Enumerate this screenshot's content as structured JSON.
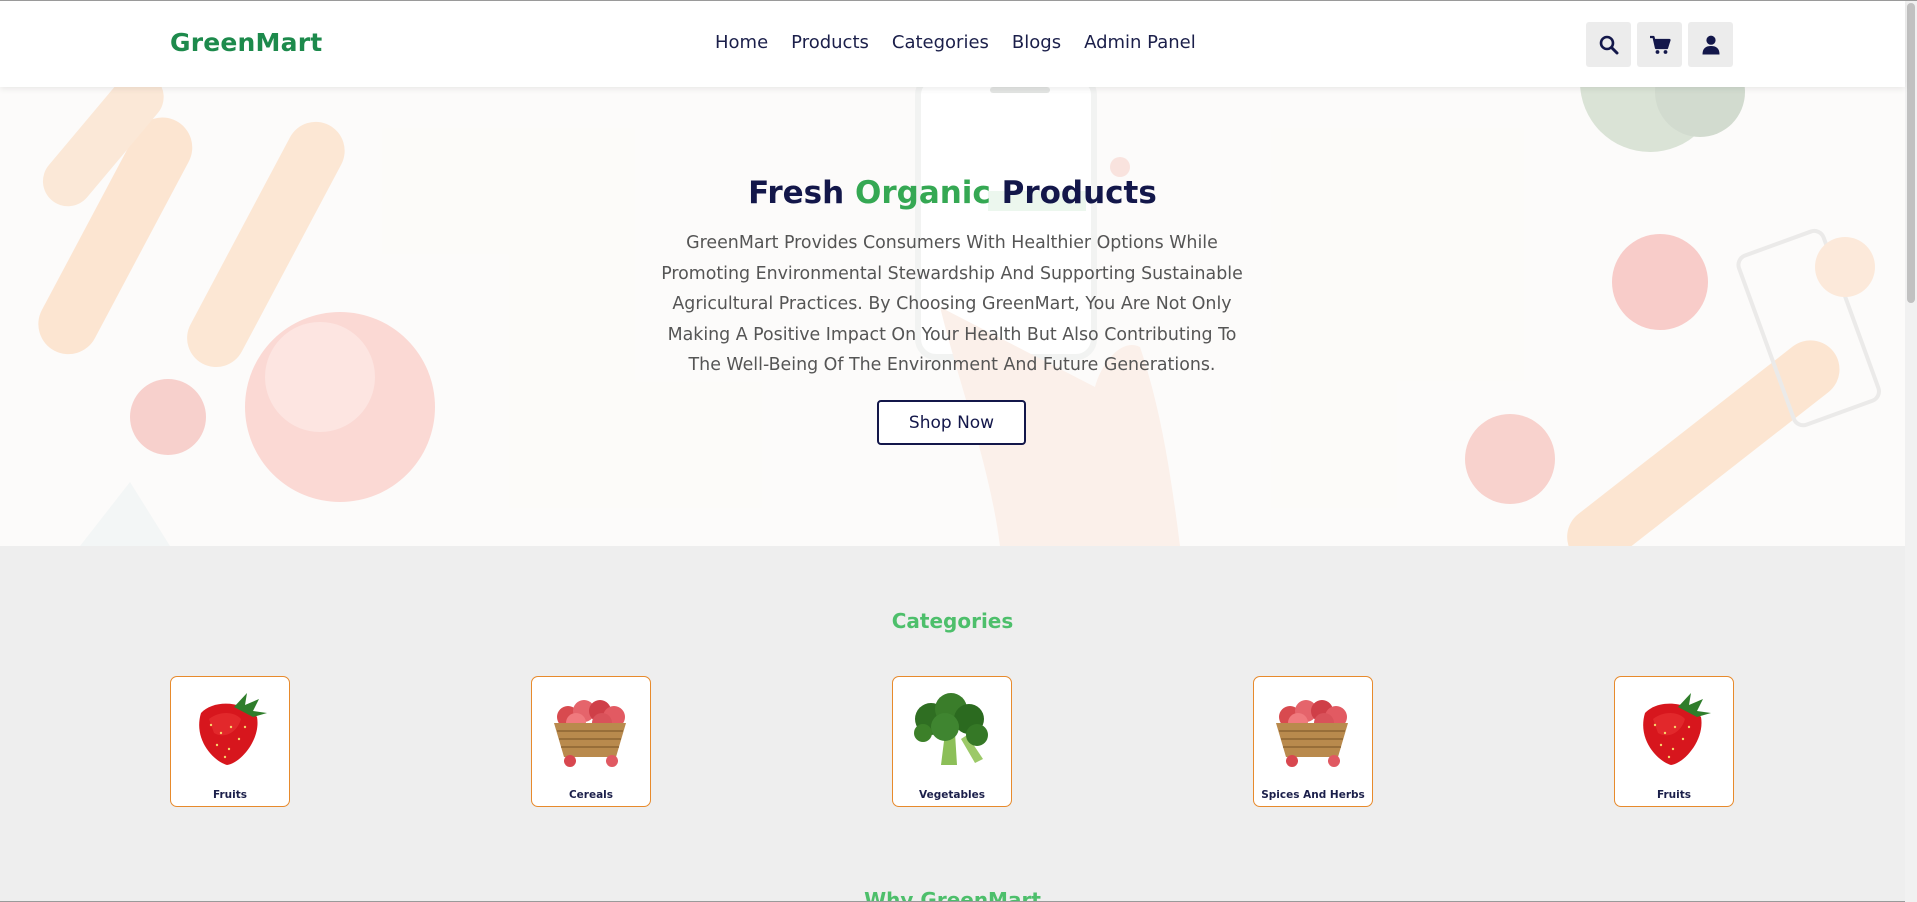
{
  "brand": {
    "name": "GreenMart",
    "color": "#1d8a4c"
  },
  "nav": {
    "items": [
      {
        "label": "Home"
      },
      {
        "label": "Products"
      },
      {
        "label": "Categories"
      },
      {
        "label": "Blogs"
      },
      {
        "label": "Admin Panel"
      }
    ]
  },
  "header_icons": [
    "search-icon",
    "cart-icon",
    "user-icon"
  ],
  "hero": {
    "title_part1": "Fresh ",
    "title_accent": "Organic",
    "title_part2": " Products",
    "description": "GreenMart Provides Consumers With Healthier Options While Promoting Environmental Stewardship And Supporting Sustainable Agricultural Practices. By Choosing GreenMart, You Are Not Only Making A Positive Impact On Your Health But Also Contributing To The Well-Being Of The Environment And Future Generations.",
    "cta_label": "Shop Now",
    "accent_color": "#35a853"
  },
  "categories": {
    "heading": "Categories",
    "items": [
      {
        "label": "Fruits",
        "image": "strawberry"
      },
      {
        "label": "Cereals",
        "image": "basket-of-apples"
      },
      {
        "label": "Vegetables",
        "image": "broccoli"
      },
      {
        "label": "Spices And Herbs",
        "image": "basket-of-apples"
      },
      {
        "label": "Fruits",
        "image": "strawberry"
      }
    ],
    "card_border_color": "#e78a2c"
  },
  "why": {
    "heading": "Why GreenMart"
  }
}
